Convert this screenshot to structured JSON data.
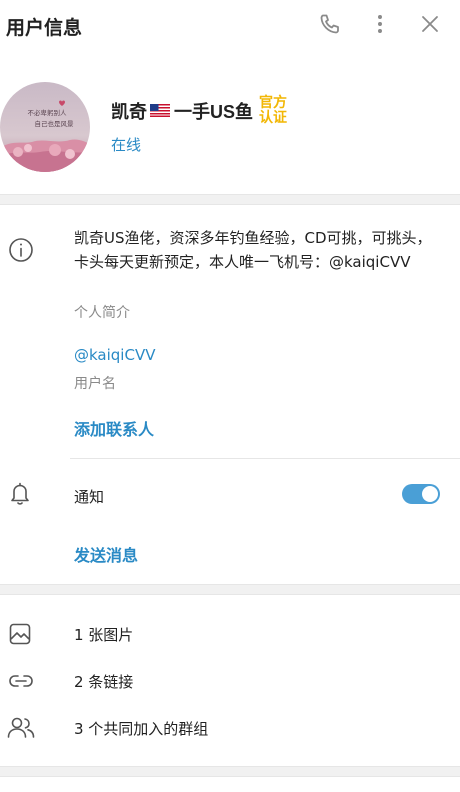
{
  "header": {
    "title": "用户信息",
    "icons": [
      "phone-icon",
      "more-vertical-icon",
      "close-icon"
    ]
  },
  "profile": {
    "name_prefix": "凯奇",
    "flag": "🇺🇸",
    "name_suffix": "一手US鱼",
    "badge_line1": "官方",
    "badge_line2": "认证",
    "status": "在线",
    "avatar_text_line1": "不必卑躬别人",
    "avatar_text_line2": "自己也是风景"
  },
  "info": {
    "bio": "凯奇US渔佬，资深多年钓鱼经验，CD可挑，可挑头，卡头每天更新预定，本人唯一飞机号：@kaiqiCVV",
    "bio_label": "个人简介",
    "username": "@kaiqiCVV",
    "username_label": "用户名",
    "add_contact": "添加联系人",
    "notifications_label": "通知",
    "notifications_on": true,
    "send_message": "发送消息"
  },
  "media": {
    "photos": "1 张图片",
    "links": "2 条链接",
    "groups": "3 个共同加入的群组"
  },
  "colors": {
    "accent": "#2a8ac5",
    "badge": "#f2b705",
    "toggle": "#4a9fd6"
  }
}
